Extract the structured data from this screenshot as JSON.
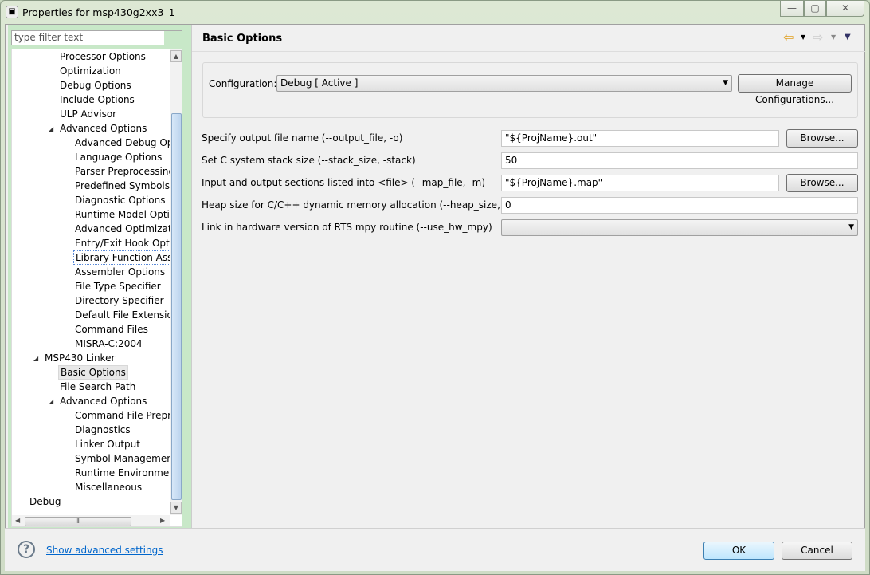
{
  "window": {
    "title": "Properties for msp430g2xx3_1",
    "minimize": "—",
    "maximize": "▢",
    "close": "✕"
  },
  "filter": {
    "placeholder": "type filter text"
  },
  "tree": [
    {
      "label": "Processor Options",
      "level": 2
    },
    {
      "label": "Optimization",
      "level": 2
    },
    {
      "label": "Debug Options",
      "level": 2
    },
    {
      "label": "Include Options",
      "level": 2
    },
    {
      "label": "ULP Advisor",
      "level": 2
    },
    {
      "label": "Advanced Options",
      "level": 2,
      "expanded": true
    },
    {
      "label": "Advanced Debug Opti",
      "level": 3
    },
    {
      "label": "Language Options",
      "level": 3
    },
    {
      "label": "Parser Preprocessing C",
      "level": 3
    },
    {
      "label": "Predefined Symbols",
      "level": 3
    },
    {
      "label": "Diagnostic Options",
      "level": 3
    },
    {
      "label": "Runtime Model Option",
      "level": 3
    },
    {
      "label": "Advanced Optimizatio",
      "level": 3
    },
    {
      "label": "Entry/Exit Hook Option",
      "level": 3
    },
    {
      "label": "Library Function Assur",
      "level": 3,
      "focused": true
    },
    {
      "label": "Assembler Options",
      "level": 3
    },
    {
      "label": "File Type Specifier",
      "level": 3
    },
    {
      "label": "Directory Specifier",
      "level": 3
    },
    {
      "label": "Default File Extensions",
      "level": 3
    },
    {
      "label": "Command Files",
      "level": 3
    },
    {
      "label": "MISRA-C:2004",
      "level": 3
    },
    {
      "label": "MSP430 Linker",
      "level": 1,
      "expanded": true
    },
    {
      "label": "Basic Options",
      "level": 2,
      "selected": true
    },
    {
      "label": "File Search Path",
      "level": 2
    },
    {
      "label": "Advanced Options",
      "level": 2,
      "expanded": true
    },
    {
      "label": "Command File Preproc",
      "level": 3
    },
    {
      "label": "Diagnostics",
      "level": 3
    },
    {
      "label": "Linker Output",
      "level": 3
    },
    {
      "label": "Symbol Management",
      "level": 3
    },
    {
      "label": "Runtime Environment",
      "level": 3
    },
    {
      "label": "Miscellaneous",
      "level": 3
    },
    {
      "label": "Debug",
      "level": 0
    }
  ],
  "page": {
    "title": "Basic Options",
    "nav": {
      "back": "⇦",
      "forward": "⇨",
      "menu": "▼"
    }
  },
  "config": {
    "label": "Configuration:",
    "value": "Debug  [ Active ]",
    "manage": "Manage Configurations..."
  },
  "options": [
    {
      "label": "Specify output file name (--output_file, -o)",
      "value": "\"${ProjName}.out\"",
      "browse": "Browse..."
    },
    {
      "label": "Set C system stack size (--stack_size, -stack)",
      "value": "50"
    },
    {
      "label": "Input and output sections listed into <file> (--map_file, -m)",
      "value": "\"${ProjName}.map\"",
      "browse": "Browse..."
    },
    {
      "label": "Heap size for C/C++ dynamic memory allocation (--heap_size, -heap)",
      "value": "0"
    },
    {
      "label": "Link in hardware version of RTS mpy routine (--use_hw_mpy)",
      "value": "",
      "type": "combo"
    }
  ],
  "footer": {
    "help": "?",
    "advanced": "Show advanced settings",
    "ok": "OK",
    "cancel": "Cancel"
  }
}
